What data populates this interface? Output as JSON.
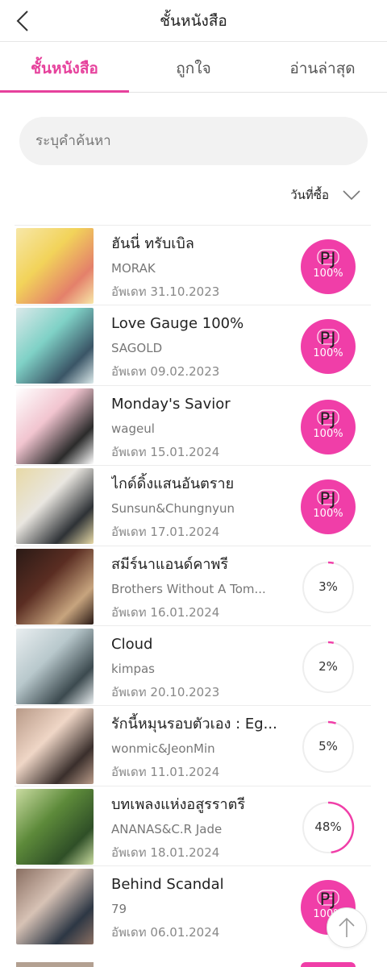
{
  "header": {
    "title": "ชั้นหนังสือ",
    "back_icon": "chevron-left-icon"
  },
  "tabs": [
    {
      "label": "ชั้นหนังสือ",
      "active": true
    },
    {
      "label": "ถูกใจ",
      "active": false
    },
    {
      "label": "อ่านล่าสุด",
      "active": false
    }
  ],
  "search": {
    "placeholder": "ระบุคำค้นหา",
    "value": ""
  },
  "sort": {
    "label": "วันที่ซื้อ",
    "icon": "chevron-down-icon"
  },
  "colors": {
    "accent": "#e6419c",
    "badge": "#f03ea8",
    "text": "#222222",
    "muted": "#777777"
  },
  "books": [
    {
      "title": "ฮันนี่ ทรับเบิล",
      "author": "MORAK",
      "updated": "อัพเดท 31.10.2023",
      "badge_text": "PJ",
      "progress_label": "100%",
      "progress": 1.0,
      "complete": true,
      "cover_colors": [
        "#f2d35a",
        "#e4806a",
        "#f7e7a8"
      ]
    },
    {
      "title": "Love Gauge 100%",
      "author": "SAGOLD",
      "updated": "อัพเดท 09.02.2023",
      "badge_text": "PJ",
      "progress_label": "100%",
      "progress": 1.0,
      "complete": true,
      "cover_colors": [
        "#7fd1c6",
        "#3a5566",
        "#dbe9ea"
      ]
    },
    {
      "title": "Monday's Savior",
      "author": "wageul",
      "updated": "อัพเดท 15.01.2024",
      "badge_text": "PJ",
      "progress_label": "100%",
      "progress": 1.0,
      "complete": true,
      "cover_colors": [
        "#f1c4cf",
        "#2b2b2b",
        "#ffffff"
      ]
    },
    {
      "title": "ไกด์ดิ้งแสนอันตราย",
      "author": "Sunsun&Chungnyun",
      "updated": "อัพเดท 17.01.2024",
      "badge_text": "PJ",
      "progress_label": "100%",
      "progress": 1.0,
      "complete": true,
      "cover_colors": [
        "#e9e6e0",
        "#2e3236",
        "#e7d9a6"
      ]
    },
    {
      "title": "สมีร์นาแอนด์คาพรี",
      "author": "Brothers Without A Tom...",
      "updated": "อัพเดท 16.01.2024",
      "badge_text": "",
      "progress_label": "3%",
      "progress": 0.03,
      "complete": false,
      "cover_colors": [
        "#5a2d22",
        "#c7a47e",
        "#2a1a16"
      ]
    },
    {
      "title": "Cloud",
      "author": "kimpas",
      "updated": "อัพเดท 20.10.2023",
      "badge_text": "",
      "progress_label": "2%",
      "progress": 0.02,
      "complete": false,
      "cover_colors": [
        "#b8c8cc",
        "#3c4a4f",
        "#e9eef0"
      ]
    },
    {
      "title": "รักนี้หมุนรอบตัวเอง : Eg...",
      "author": "wonmic&JeonMin",
      "updated": "อัพเดท 11.01.2024",
      "badge_text": "",
      "progress_label": "5%",
      "progress": 0.05,
      "complete": false,
      "cover_colors": [
        "#efd6c6",
        "#3a2f2c",
        "#b89a88"
      ]
    },
    {
      "title": "บทเพลงแห่งอสูรราตรี",
      "author": "ANANAS&C.R Jade",
      "updated": "อัพเดท 18.01.2024",
      "badge_text": "",
      "progress_label": "48%",
      "progress": 0.48,
      "complete": false,
      "cover_colors": [
        "#5d8a3a",
        "#2f4f27",
        "#c9dba0"
      ]
    },
    {
      "title": "Behind Scandal",
      "author": "79",
      "updated": "อัพเดท 06.01.2024",
      "badge_text": "PJ",
      "progress_label": "100%",
      "progress": 1.0,
      "complete": true,
      "cover_colors": [
        "#d7c2b5",
        "#2d3744",
        "#8a6f62"
      ]
    }
  ],
  "scroll_top_icon": "arrow-up-icon"
}
